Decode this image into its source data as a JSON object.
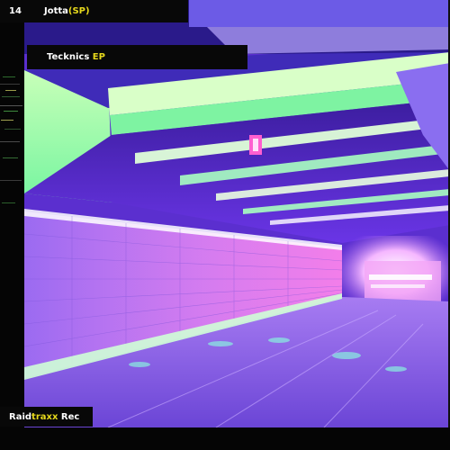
{
  "cover": {
    "track_number": "14",
    "artist_name": "Jotta",
    "artist_suffix": "(SP)",
    "release_title": "Tecknics",
    "release_type": "EP",
    "label_part1": "Raid",
    "label_part2": "traxx",
    "label_part3": " Rec"
  },
  "colors": {
    "accent_yellow": "#e6d81c",
    "neon_green": "#8dff9b",
    "neon_purple": "#7b3cff",
    "neon_pink": "#ff4fd8"
  }
}
